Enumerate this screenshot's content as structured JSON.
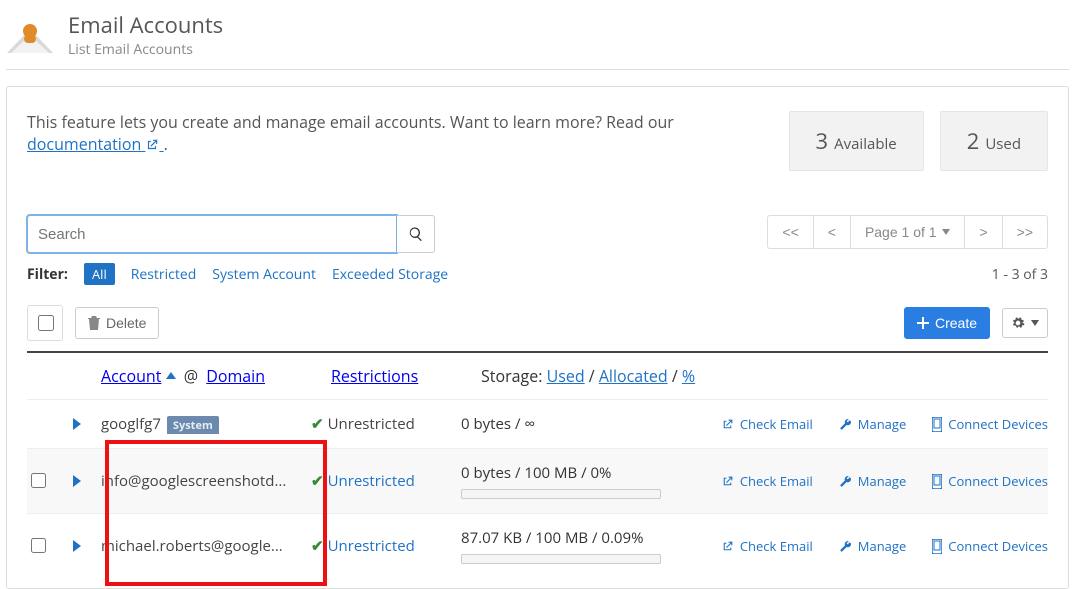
{
  "header": {
    "title": "Email Accounts",
    "subtitle": "List Email Accounts"
  },
  "intro": {
    "text_prefix": "This feature lets you create and manage email accounts. Want to learn more? Read our ",
    "link_label": "documentation",
    "text_suffix": " ."
  },
  "stats": {
    "available_num": "3",
    "available_label": "Available",
    "used_num": "2",
    "used_label": "Used"
  },
  "search": {
    "placeholder": "Search"
  },
  "pager": {
    "first": "<<",
    "prev": "<",
    "page_label": "Page 1 of 1",
    "next": ">",
    "last": ">>"
  },
  "filter": {
    "label": "Filter:",
    "all": "All",
    "restricted": "Restricted",
    "system": "System Account",
    "exceeded": "Exceeded Storage",
    "count": "1 - 3 of 3"
  },
  "toolbar": {
    "delete_label": "Delete",
    "create_label": "Create"
  },
  "columns": {
    "account": "Account",
    "at": "@",
    "domain": "Domain",
    "restrictions": "Restrictions",
    "storage_prefix": "Storage:",
    "storage_used": "Used",
    "storage_allocated": "Allocated",
    "storage_pct": "%"
  },
  "actions": {
    "check": "Check Email",
    "manage": "Manage",
    "connect": "Connect Devices"
  },
  "rows": [
    {
      "account": "googlfg7",
      "system": true,
      "system_label": "System",
      "restriction": "Unrestricted",
      "restriction_is_link": false,
      "storage": "0 bytes / ∞",
      "show_progress": false,
      "show_checkbox": false
    },
    {
      "account": "info@googlescreenshotd...",
      "system": false,
      "restriction": "Unrestricted",
      "restriction_is_link": true,
      "storage": "0 bytes / 100 MB / 0%",
      "show_progress": true,
      "show_checkbox": true
    },
    {
      "account": "michael.roberts@google...",
      "system": false,
      "restriction": "Unrestricted",
      "restriction_is_link": true,
      "storage": "87.07 KB / 100 MB / 0.09%",
      "show_progress": true,
      "show_checkbox": true
    }
  ]
}
